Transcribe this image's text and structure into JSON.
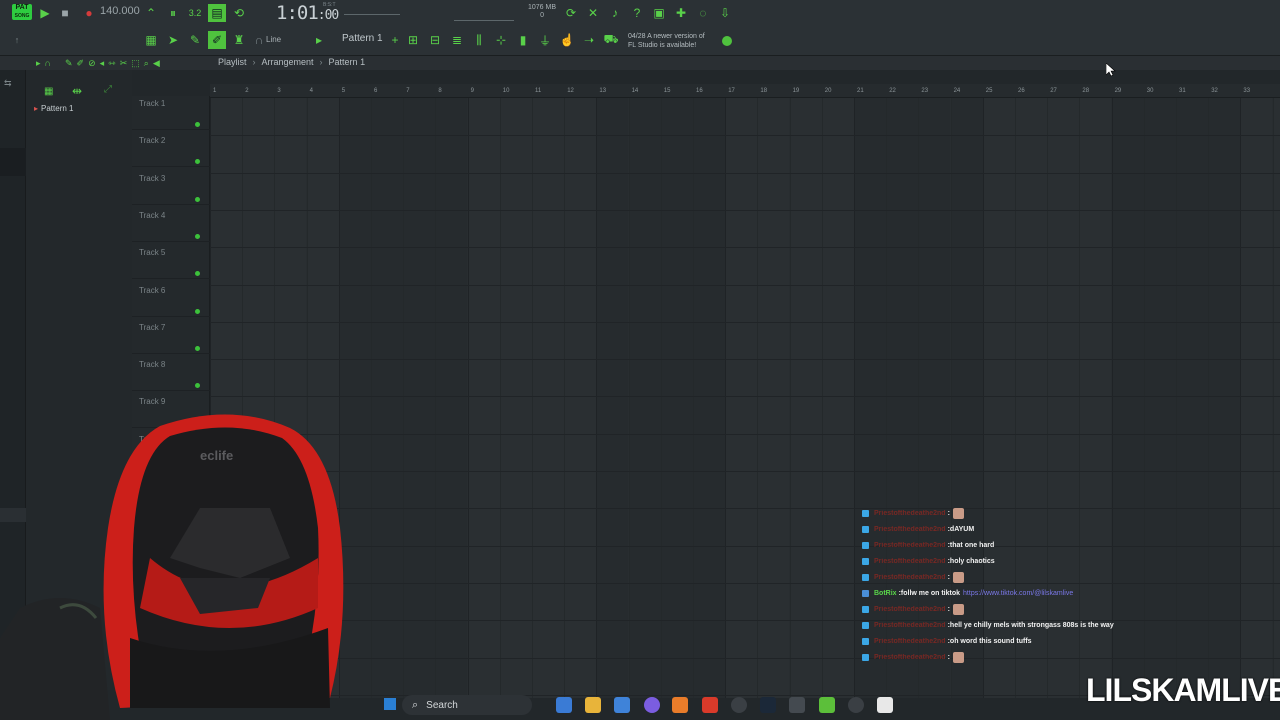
{
  "toolbar": {
    "pat_label": "PAT",
    "song_label": "SONG",
    "tempo": "140.000",
    "clock": "1:01",
    "clock_sub": ":00",
    "bst_label": "B:S:T",
    "memory": "1076 MB",
    "memory_sub": "0",
    "snap_mode": "Line",
    "pattern_selector": "Pattern 1",
    "news_date": "04/28",
    "news_text_line1": "A newer version of",
    "news_text_line2": "FL Studio is available!"
  },
  "playlist": {
    "title": "Playlist",
    "section": "Arrangement",
    "pattern": "Pattern 1"
  },
  "pattern_list": {
    "items": [
      "Pattern 1"
    ]
  },
  "tracks": [
    "Track 1",
    "Track 2",
    "Track 3",
    "Track 4",
    "Track 5",
    "Track 6",
    "Track 7",
    "Track 8",
    "Track 9",
    "Track 10"
  ],
  "ruler": [
    "1",
    "2",
    "3",
    "4",
    "5",
    "6",
    "7",
    "8",
    "9",
    "10",
    "11",
    "12",
    "13",
    "14",
    "15",
    "16",
    "17",
    "18",
    "19",
    "20",
    "21",
    "22",
    "23",
    "24",
    "25",
    "26",
    "27",
    "28",
    "29",
    "30",
    "31",
    "32",
    "33"
  ],
  "chat": [
    {
      "user": "Priestofthedeathe2nd",
      "text": "",
      "emote": true,
      "bot": false
    },
    {
      "user": "Priestofthedeathe2nd",
      "text": "dAYUM",
      "emote": false,
      "bot": false
    },
    {
      "user": "Priestofthedeathe2nd",
      "text": "that one hard",
      "emote": false,
      "bot": false
    },
    {
      "user": "Priestofthedeathe2nd",
      "text": "holy chaotics",
      "emote": false,
      "bot": false
    },
    {
      "user": "Priestofthedeathe2nd",
      "text": "",
      "emote": true,
      "bot": false
    },
    {
      "user": "BotRix",
      "text": "follw me on tiktok",
      "link": "https://www.tiktok.com/@lilskamlive",
      "emote": false,
      "bot": true
    },
    {
      "user": "Priestofthedeathe2nd",
      "text": "",
      "emote": true,
      "bot": false
    },
    {
      "user": "Priestofthedeathe2nd",
      "text": "hell ye chilly mels with strongass 808s is the way",
      "emote": false,
      "bot": false
    },
    {
      "user": "Priestofthedeathe2nd",
      "text": "oh word this sound tuffs",
      "emote": false,
      "bot": false
    },
    {
      "user": "Priestofthedeathe2nd",
      "text": "",
      "emote": true,
      "bot": false
    }
  ],
  "chair_brand": "eclife",
  "watermark": "LILSKAMLIVE",
  "taskbar": {
    "search_placeholder": "Search"
  },
  "colors": {
    "fl_green": "#59d14a",
    "chat_user": "#b9261c",
    "bot_user": "#5ad64a",
    "link": "#7a78e8"
  }
}
